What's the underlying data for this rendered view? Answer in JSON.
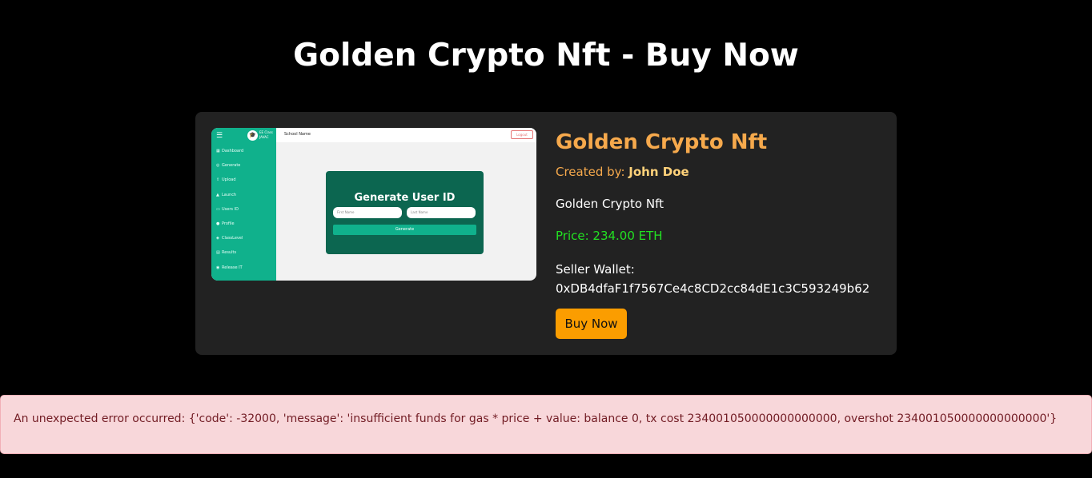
{
  "page": {
    "title": "Golden Crypto Nft - Buy Now"
  },
  "nft": {
    "name": "Golden Crypto Nft",
    "created_by_label": "Created by:",
    "creator": "John Doe",
    "description": "Golden Crypto Nft",
    "price": "Price: 234.00 ETH",
    "seller_wallet_label": "Seller Wallet:",
    "seller_wallet": "0xDB4dfaF1f7567Ce4c8CD2cc84dE1c3C593249b62",
    "buy_label": "Buy Now"
  },
  "preview": {
    "brand": "EE Class JAVAC",
    "school_name": "School Name",
    "logout": "Logout",
    "nav": [
      "Dashboard",
      "Generate",
      "Upload",
      "Launch",
      "Users ID",
      "Profile",
      "ClassLevel",
      "Results",
      "Release IT"
    ],
    "modal_title": "Generate User ID",
    "first_name_placeholder": "First Name",
    "last_name_placeholder": "Last Name",
    "generate_button": "Generate"
  },
  "error": {
    "message": "An unexpected error occurred: {'code': -32000, 'message': 'insufficient funds for gas * price + value: balance 0, tx cost 234001050000000000000, overshot 234001050000000000000'}"
  },
  "colors": {
    "background": "#000000",
    "card": "#222222",
    "accent_orange": "#f6a94c",
    "price_green": "#22e022",
    "button_orange": "#fb9d00",
    "error_bg": "#f8d7da",
    "error_text": "#721c24",
    "preview_teal": "#10b18c",
    "preview_modal": "#0c6650"
  }
}
